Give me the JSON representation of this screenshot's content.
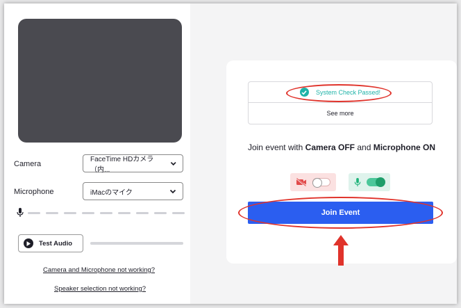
{
  "left": {
    "camera_label": "Camera",
    "camera_value": "FaceTime HDカメラ（内...",
    "microphone_label": "Microphone",
    "microphone_value": "iMacのマイク",
    "test_audio_label": "Test Audio",
    "link_camera_mic": "Camera and Microphone not working?",
    "link_speaker": "Speaker selection not working?"
  },
  "card": {
    "system_check": "System Check Passed!",
    "see_more": "See more",
    "join_prefix": "Join event with ",
    "camera_state": "Camera OFF",
    "join_middle": " and ",
    "mic_state": "Microphone ON",
    "join_button": "Join Event"
  },
  "colors": {
    "primary": "#2b5ef0",
    "success": "#1fb3a8",
    "annotation": "#e0332b",
    "camera_off_bg": "#fbe1e1",
    "mic_on_bg": "#dff3ec"
  }
}
